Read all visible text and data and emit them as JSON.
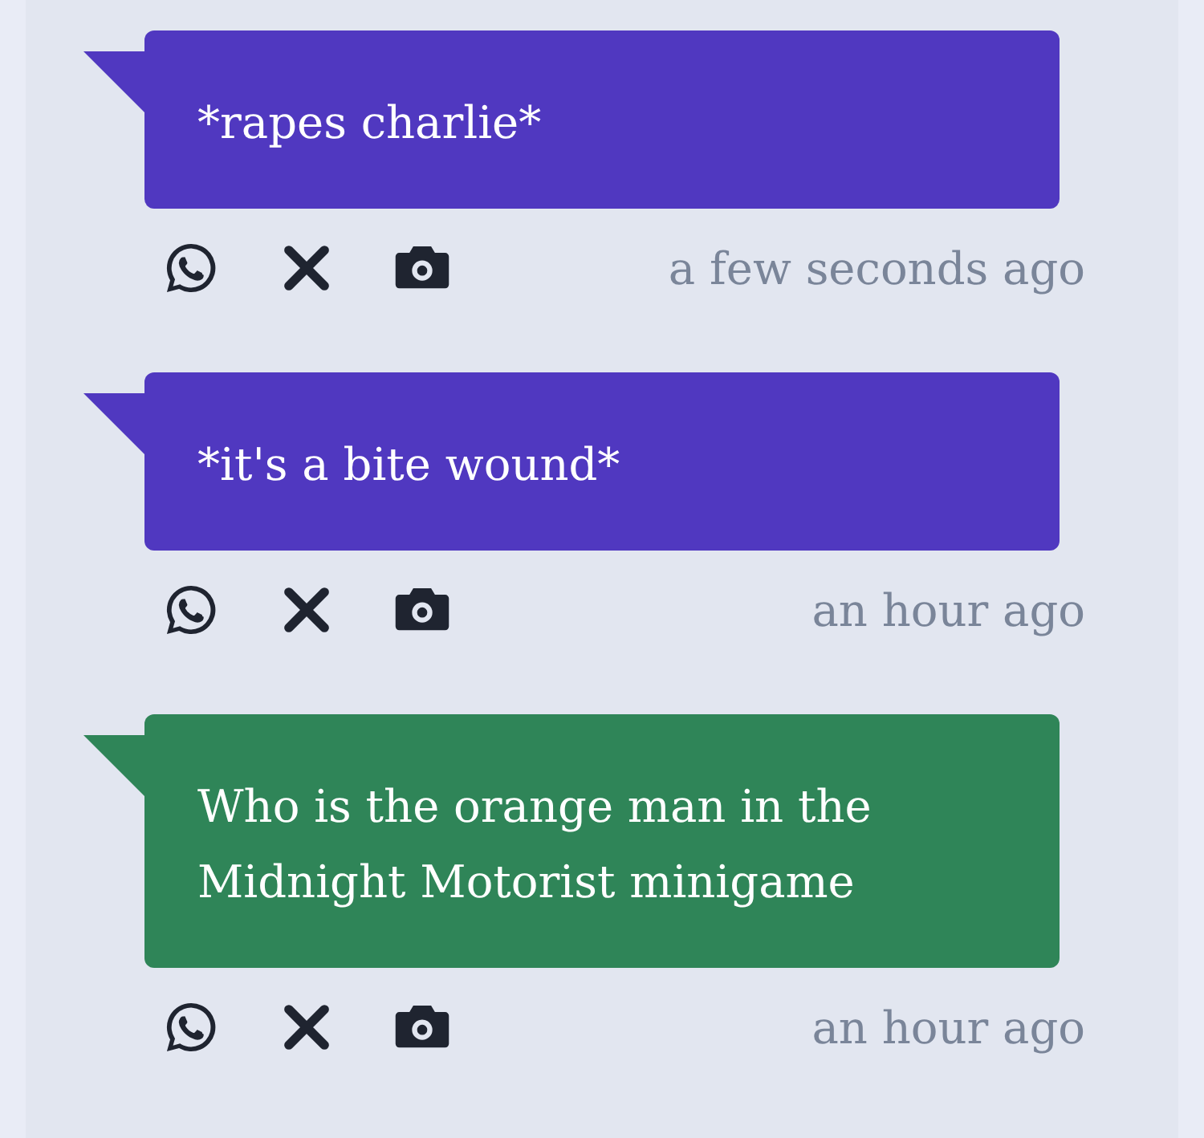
{
  "messages": [
    {
      "text": "*rapes charlie*",
      "color": "#5038c0",
      "time": "a few seconds ago"
    },
    {
      "text": "*it's a bite wound*",
      "color": "#5038c0",
      "time": "an hour ago"
    },
    {
      "text": "Who is the orange man in the Midnight Motorist minigame",
      "color": "#2f8558",
      "time": "an hour ago"
    }
  ]
}
